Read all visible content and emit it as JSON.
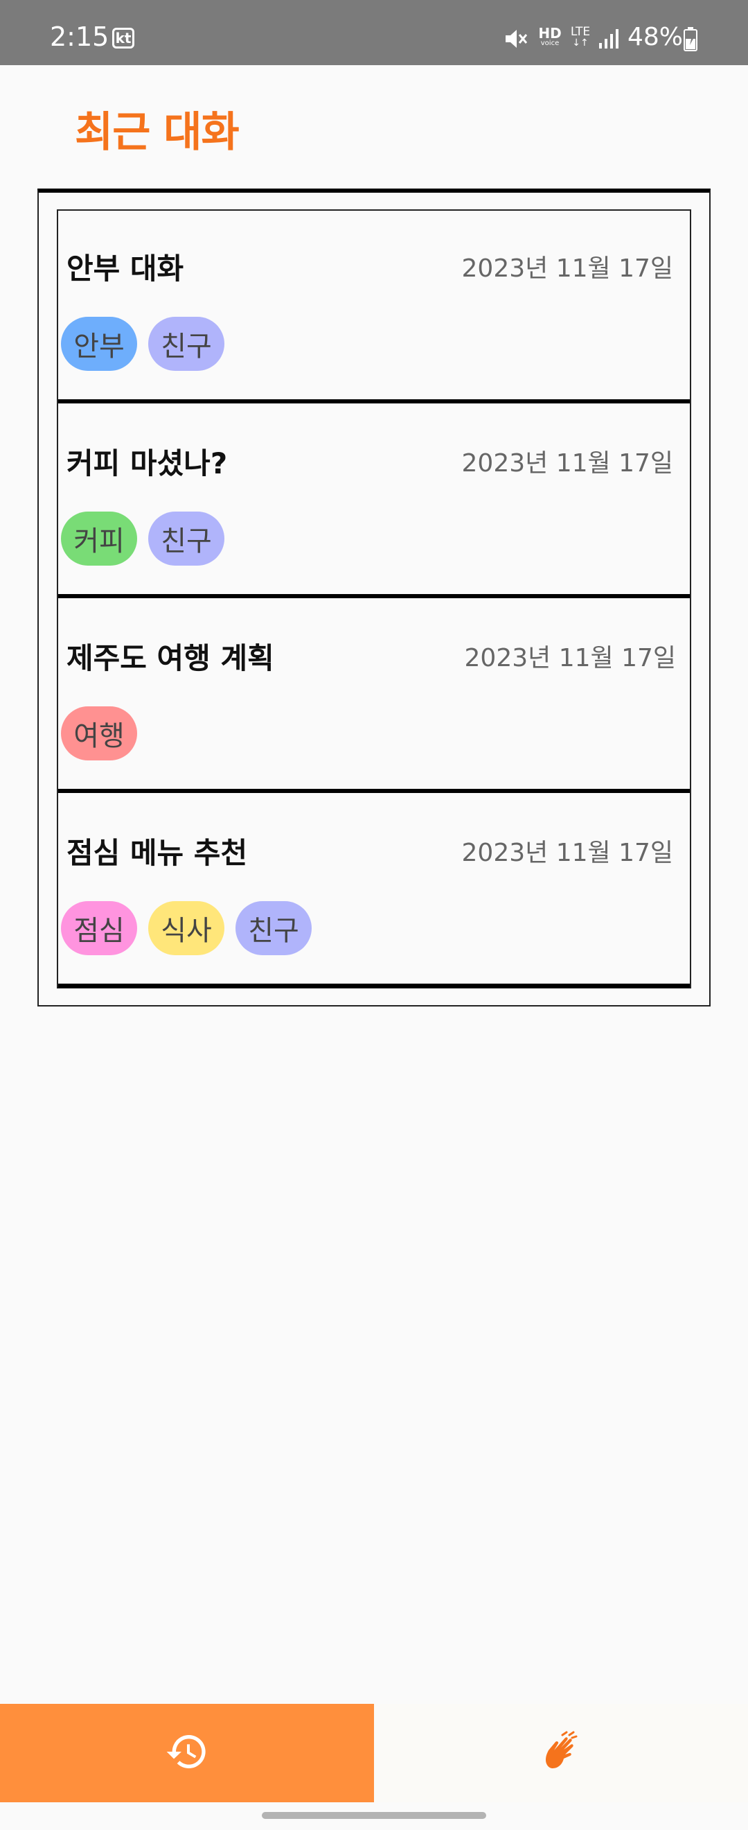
{
  "status_bar": {
    "time": "2:15",
    "carrier": "kt",
    "network_label_hd": "HD",
    "network_label_voice": "voice",
    "network_label_lte": "LTE",
    "battery": "48%"
  },
  "page": {
    "title": "최근 대화"
  },
  "conversations": [
    {
      "title": "안부 대화",
      "date": "2023년 11월 17일",
      "tags": [
        {
          "label": "안부",
          "color": "#6eaefc"
        },
        {
          "label": "친구",
          "color": "#b0b4fb"
        }
      ]
    },
    {
      "title": "커피 마셨나?",
      "date": "2023년 11월 17일",
      "tags": [
        {
          "label": "커피",
          "color": "#79dc76"
        },
        {
          "label": "친구",
          "color": "#b0b4fb"
        }
      ]
    },
    {
      "title": "제주도 여행 계획",
      "date": "2023년 11월 17일",
      "tags": [
        {
          "label": "여행",
          "color": "#ff9191"
        }
      ]
    },
    {
      "title": "점심 메뉴 추천",
      "date": "2023년 11월 17일",
      "tags": [
        {
          "label": "점심",
          "color": "#ff94df"
        },
        {
          "label": "식사",
          "color": "#ffe67a"
        },
        {
          "label": "친구",
          "color": "#b0b4fb"
        }
      ]
    }
  ],
  "bottom_nav": {
    "items": [
      {
        "icon": "history-icon",
        "active": true
      },
      {
        "icon": "sign-language-icon",
        "active": false
      }
    ],
    "active_color": "#ff8f3c",
    "accent_color": "#f5731c"
  }
}
